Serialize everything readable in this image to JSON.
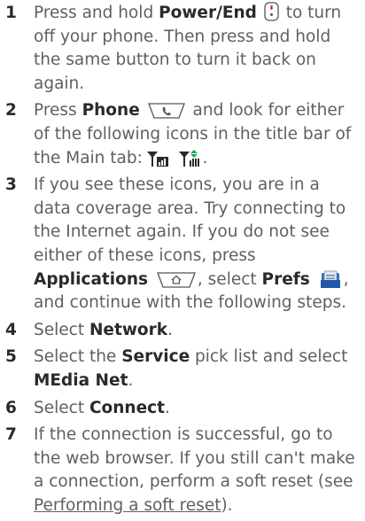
{
  "steps": [
    {
      "num": "1",
      "t1": "Press and hold ",
      "b1": "Power/End",
      "t2": " to turn off your phone. Then press and hold the same button to turn it back on again."
    },
    {
      "num": "2",
      "t1": "Press ",
      "b1": "Phone",
      "t2": " and look for either of the following icons in the title bar of the Main tab: ",
      "t3": "."
    },
    {
      "num": "3",
      "t1": "If you see these icons, you are in a data coverage area. Try connecting to the Internet again. If you do not see either of these icons, press",
      "b1": "Applications",
      "t2": ", select ",
      "b2": "Prefs",
      "t3": ", and continue with the following steps."
    },
    {
      "num": "4",
      "t1": "Select ",
      "b1": "Network",
      "t2": "."
    },
    {
      "num": "5",
      "t1": "Select the ",
      "b1": "Service",
      "t2": " pick list and select ",
      "b2": "MEdia Net",
      "t3": "."
    },
    {
      "num": "6",
      "t1": "Select ",
      "b1": "Connect",
      "t2": "."
    },
    {
      "num": "7",
      "t1": "If the connection is successful, go to the web browser. If you still can't make a connection, perform a soft reset (see ",
      "link": "Performing a soft reset",
      "t2": ")."
    }
  ],
  "icons": {
    "power_end": "power-end-button-icon",
    "phone": "phone-button-icon",
    "signal_data": "signal-data-icon",
    "signal_data_active": "signal-data-active-icon",
    "applications": "applications-button-icon",
    "prefs": "prefs-app-icon"
  },
  "colors": {
    "body_text": "#5f5f5f",
    "bold_text": "#2a2a2a",
    "power_icon_red": "#d03030",
    "data_icon_green": "#17a85a",
    "prefs_icon_blue": "#2e6fc4"
  }
}
